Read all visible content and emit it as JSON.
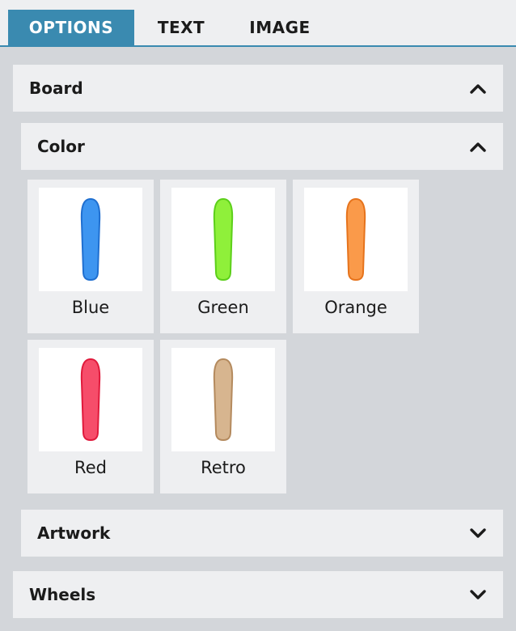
{
  "tabs": [
    {
      "label": "OPTIONS",
      "active": true
    },
    {
      "label": "TEXT",
      "active": false
    },
    {
      "label": "IMAGE",
      "active": false
    }
  ],
  "sections": {
    "board": {
      "title": "Board",
      "expanded": true
    },
    "color": {
      "title": "Color",
      "expanded": true
    },
    "artwork": {
      "title": "Artwork",
      "expanded": false
    },
    "wheels": {
      "title": "Wheels",
      "expanded": false
    }
  },
  "colors": [
    {
      "name": "Blue",
      "fill": "#3d95f0",
      "edge": "#1f6fd0"
    },
    {
      "name": "Green",
      "fill": "#8ff03a",
      "edge": "#5ccf1a"
    },
    {
      "name": "Orange",
      "fill": "#fa9a4a",
      "edge": "#e6731c"
    },
    {
      "name": "Red",
      "fill": "#f64d6a",
      "edge": "#e01a3c"
    },
    {
      "name": "Retro",
      "fill": "#d7b58f",
      "edge": "#b48a5e"
    }
  ],
  "theme": {
    "accent": "#3a8ab0",
    "panel": "#eeeff1",
    "background": "#d3d6da"
  }
}
